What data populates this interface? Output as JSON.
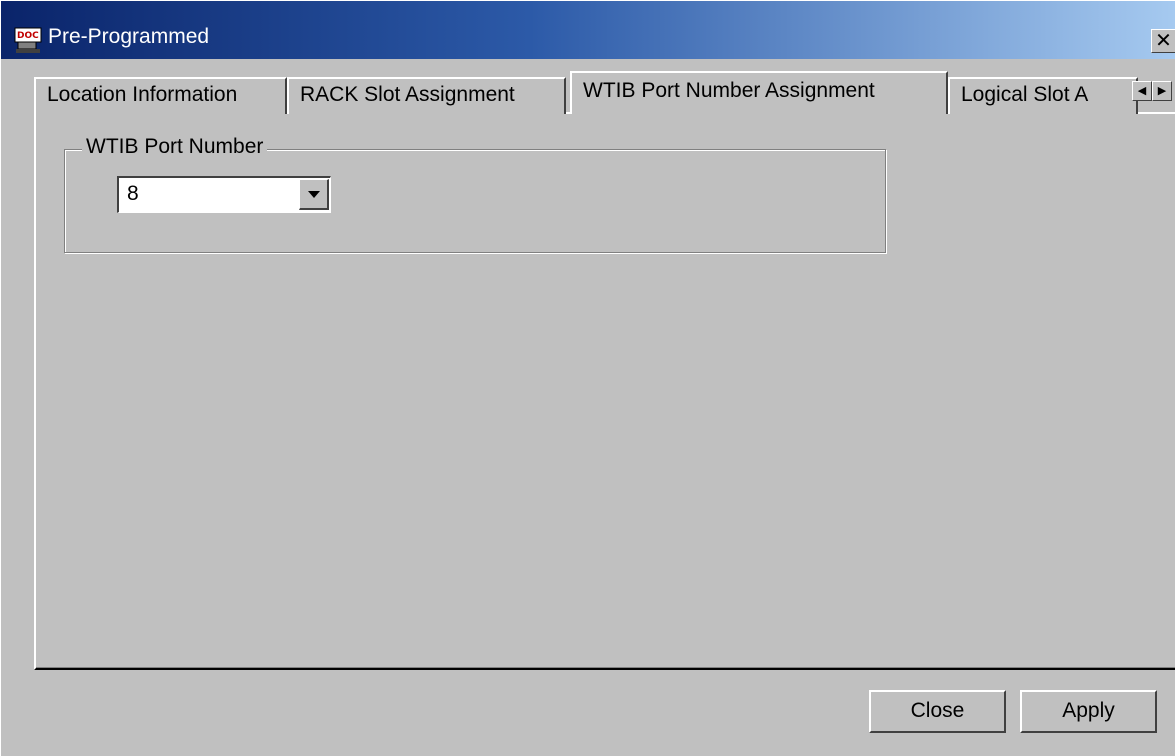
{
  "window": {
    "title": "Pre-Programmed",
    "close_symbol": "✕",
    "icon": "doc-app-icon"
  },
  "tabs": [
    {
      "label": "Location Information",
      "active": false
    },
    {
      "label": "RACK Slot Assignment",
      "active": false
    },
    {
      "label": "WTIB Port Number Assignment",
      "active": true
    },
    {
      "label": "Logical Slot A",
      "active": false
    }
  ],
  "tab_scroll": {
    "left_symbol": "◀",
    "right_symbol": "▶"
  },
  "group": {
    "label": "WTIB Port Number",
    "port_select": {
      "value": "8"
    }
  },
  "buttons": {
    "close_label": "Close",
    "apply_label": "Apply"
  },
  "colors": {
    "titlebar_start": "#0a246a",
    "titlebar_end": "#a6caf0",
    "face": "#c0c0c0"
  }
}
